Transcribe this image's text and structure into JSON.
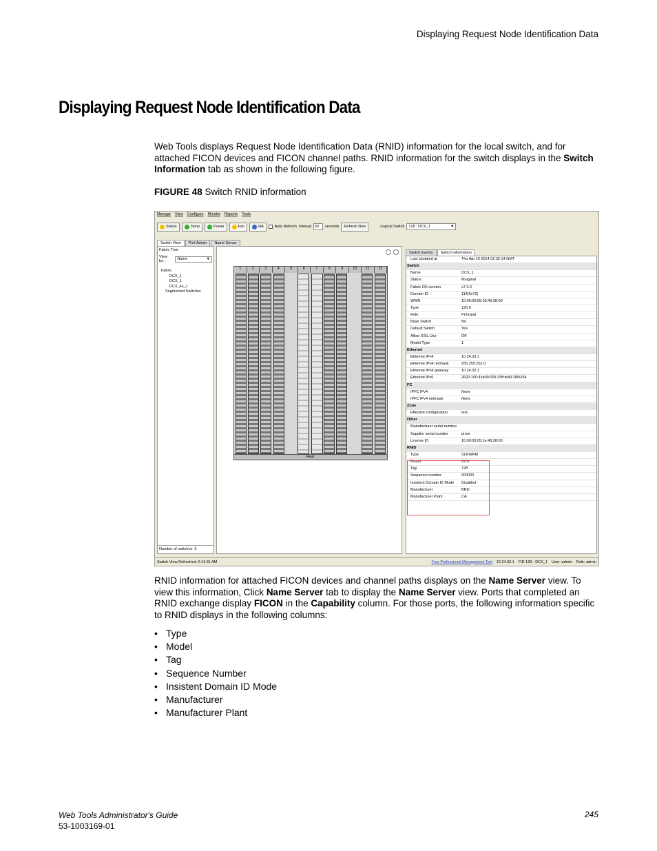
{
  "running_head": "Displaying Request Node Identification Data",
  "heading": "Displaying Request Node Identification Data",
  "intro": {
    "p1_part1": "Web Tools displays Request Node Identification Data (RNID) information for the local switch, and for attached FICON devices and FICON channel paths. RNID information for the switch displays in the ",
    "p1_bold": "Switch Information",
    "p1_part2": " tab as shown in the following figure."
  },
  "figure_caption": {
    "label": "FIGURE 48",
    "text": "Switch RNID information"
  },
  "screenshot": {
    "menu": [
      "Manage",
      "View",
      "Configure",
      "Monitor",
      "Reports",
      "Tools"
    ],
    "toolbar": {
      "status": "Status",
      "temp": "Temp",
      "power": "Power",
      "fan": "Fan",
      "ha": "HA",
      "auto_refresh": "Auto Refresh",
      "interval_label": "Interval",
      "interval_value": "60",
      "seconds": "seconds",
      "refresh_now": "Refresh Now",
      "logical_switch_label": "Logical Switch",
      "logical_switch_value": "128 : DCX_1"
    },
    "left_tabs": [
      "Switch View",
      "Port Admin",
      "Name Server"
    ],
    "fabric_tree": "Fabric Tree",
    "view_by_label": "View by:",
    "view_by_value": "Name",
    "tree": [
      "Fabric",
      "DCX_1",
      "DCX_1",
      "DCX_4s_1",
      "Segmented Switches"
    ],
    "num_switches": "Number of switches:  3",
    "chassis_slots": [
      "1",
      "2",
      "3",
      "4",
      "5",
      "6",
      "7",
      "8",
      "9",
      "10",
      "11",
      "12"
    ],
    "chassis_footer": "Rear",
    "right_tabs": [
      "Switch Events",
      "Switch Information"
    ],
    "properties": [
      {
        "k": "Last Updated at",
        "v": "Thu Apr 10 2014 02:32:14 GMT",
        "sec": false
      },
      {
        "k": "Switch",
        "v": "",
        "sec": true
      },
      {
        "k": "Name",
        "v": "DCX_1",
        "sec": false
      },
      {
        "k": "Status",
        "v": "Marginal",
        "sec": false
      },
      {
        "k": "Fabric OS version",
        "v": "v7.3.0",
        "sec": false
      },
      {
        "k": "Domain ID",
        "v": "114(0x72)",
        "sec": false
      },
      {
        "k": "WWN",
        "v": "10:00:00:05:33:40:28:00",
        "sec": false
      },
      {
        "k": "Type",
        "v": "120.0",
        "sec": false
      },
      {
        "k": "Role",
        "v": "Principal",
        "sec": false
      },
      {
        "k": "Base Switch",
        "v": "No",
        "sec": false
      },
      {
        "k": "Default Switch",
        "v": "Yes",
        "sec": false
      },
      {
        "k": "Allow XISL Use",
        "v": "Off",
        "sec": false
      },
      {
        "k": "Model Type",
        "v": "1",
        "sec": false
      },
      {
        "k": "Ethernet",
        "v": "",
        "sec": true
      },
      {
        "k": "Ethernet IPv4",
        "v": "10.24.33.1",
        "sec": false
      },
      {
        "k": "Ethernet IPv4 netmask",
        "v": "255.255.252.0",
        "sec": false
      },
      {
        "k": "Ethernet IPv4 gateway",
        "v": "10.24.32.1",
        "sec": false
      },
      {
        "k": "Ethernet IPv6",
        "v": "2620:100:4:fe00:205:33ff:fe40:2800/64",
        "sec": false
      },
      {
        "k": "FC",
        "v": "",
        "sec": true
      },
      {
        "k": "IPFC IPv4",
        "v": "None",
        "sec": false
      },
      {
        "k": "IPFC IPv4 netmask",
        "v": "None",
        "sec": false
      },
      {
        "k": "Zone",
        "v": "",
        "sec": true
      },
      {
        "k": "Effective configuration",
        "v": "test",
        "sec": false
      },
      {
        "k": "Other",
        "v": "",
        "sec": true
      },
      {
        "k": "Manufacturer serial number",
        "v": "",
        "sec": false
      },
      {
        "k": "Supplier serial number",
        "v": "prom",
        "sec": false
      },
      {
        "k": "License ID",
        "v": "10:00:00:05:1e:40:28:00",
        "sec": false
      },
      {
        "k": "RNID",
        "v": "",
        "sec": true
      },
      {
        "k": "Type",
        "v": "SLKWRM",
        "sec": false
      },
      {
        "k": "Model",
        "v": "DCX",
        "sec": false
      },
      {
        "k": "Tag",
        "v": "72ff",
        "sec": false
      },
      {
        "k": "Sequence number",
        "v": "000000",
        "sec": false
      },
      {
        "k": "Insistent Domain ID Mode",
        "v": "Disabled",
        "sec": false
      },
      {
        "k": "Manufacturer",
        "v": "BRD",
        "sec": false
      },
      {
        "k": "Manufacturer Plant",
        "v": "CA",
        "sec": false
      }
    ],
    "status_bar": {
      "retrieved": "Switch View Refreshed:  6:14:31 AM",
      "link": "Free Professional Management Tool",
      "ip": "10.24.33.1",
      "fid": "FID 128 - DCX_1",
      "user": "User: admin",
      "role": "Role: admin"
    }
  },
  "para2": {
    "t1": "RNID information for attached FICON devices and channel paths displays on the ",
    "b1": "Name Server",
    "t2": " view. To view this information, Click ",
    "b2": "Name Server",
    "t3": " tab to display the ",
    "b3": "Name Server",
    "t4": " view. Ports that completed an RNID exchange display ",
    "b4": "FICON",
    "t5": " in the ",
    "b5": "Capability",
    "t6": " column. For those ports, the following information specific to RNID displays in the following columns:"
  },
  "columns": [
    "Type",
    "Model",
    "Tag",
    "Sequence Number",
    "Insistent Domain ID Mode",
    "Manufacturer",
    "Manufacturer Plant"
  ],
  "footer": {
    "title": "Web Tools Administrator's Guide",
    "doc_number": "53-1003169-01",
    "page": "245"
  }
}
